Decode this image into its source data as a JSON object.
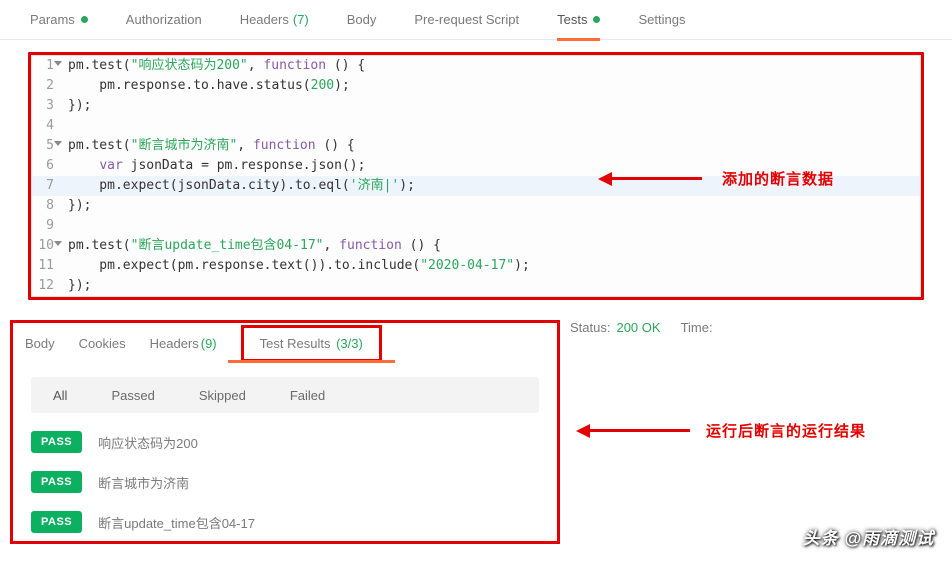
{
  "topTabs": {
    "params": "Params",
    "auth": "Authorization",
    "headers": "Headers",
    "headersCount": "(7)",
    "body": "Body",
    "prereq": "Pre-request Script",
    "tests": "Tests",
    "settings": "Settings"
  },
  "code": {
    "lines": {
      "1": "1",
      "2": "2",
      "3": "3",
      "4": "4",
      "5": "5",
      "6": "6",
      "7": "7",
      "8": "8",
      "9": "9",
      "10": "10",
      "11": "11",
      "12": "12"
    },
    "l1_a": "pm",
    "l1_b": ".test(",
    "l1_str": "\"响应状态码为200\"",
    "l1_c": ", ",
    "l1_kw": "function",
    "l1_d": " () {",
    "l2_a": "    pm.response.to.have.status(",
    "l2_num": "200",
    "l2_b": ");",
    "l3": "});",
    "l5_a": "pm",
    "l5_b": ".test(",
    "l5_str": "\"断言城市为济南\"",
    "l5_c": ", ",
    "l5_kw": "function",
    "l5_d": " () {",
    "l6_a": "    ",
    "l6_kw": "var",
    "l6_b": " jsonData = pm.response.json();",
    "l7_a": "    pm.expect(jsonData.city).to.eql(",
    "l7_str": "'济南|'",
    "l7_b": ");",
    "l8": "});",
    "l10_a": "pm",
    "l10_b": ".test(",
    "l10_str": "\"断言update_time包含04-17\"",
    "l10_c": ", ",
    "l10_kw": "function",
    "l10_d": " () {",
    "l11_a": "    pm.expect(pm.response.text()).to.include(",
    "l11_str": "\"2020-04-17\"",
    "l11_b": ");",
    "l12": "});"
  },
  "annotations": {
    "code": "添加的断言数据",
    "results": "运行后断言的运行结果"
  },
  "resultsTabs": {
    "body": "Body",
    "cookies": "Cookies",
    "headers": "Headers",
    "headersCount": "(9)",
    "testResults": "Test Results",
    "testResultsCount": "(3/3)"
  },
  "status": {
    "label": "Status:",
    "value": "200 OK",
    "timeLabel": "Time:"
  },
  "filters": {
    "all": "All",
    "passed": "Passed",
    "skipped": "Skipped",
    "failed": "Failed"
  },
  "results": {
    "badge": "PASS",
    "r1": "响应状态码为200",
    "r2": "断言城市为济南",
    "r3": "断言update_time包含04-17"
  },
  "watermark": "头条 @雨滴测试"
}
